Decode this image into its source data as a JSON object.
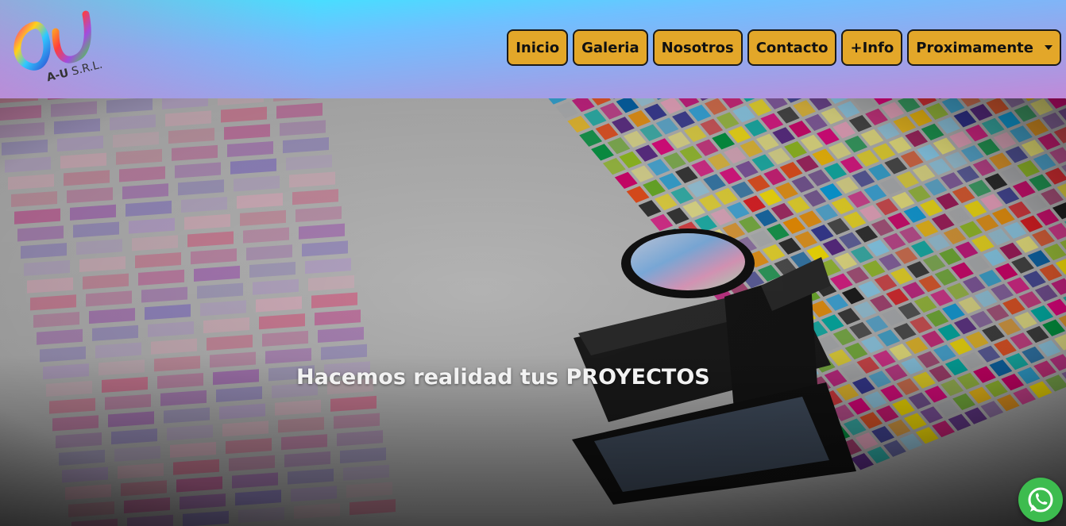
{
  "brand": {
    "logo_name": "A-U S.R.L. logo",
    "logo_text_bold": "A-U",
    "logo_text_rest": " S.R.L."
  },
  "nav": {
    "items": [
      {
        "label": "Inicio"
      },
      {
        "label": "Galeria"
      },
      {
        "label": "Nosotros"
      },
      {
        "label": "Contacto"
      },
      {
        "label": "+Info"
      },
      {
        "label": "Proximamente"
      }
    ]
  },
  "hero": {
    "title": "Hacemos realidad tus  PROYECTOS",
    "image_icon": "color-chart-loupe-photo"
  },
  "floating": {
    "whatsapp_icon": "whatsapp-icon"
  },
  "colors": {
    "nav_button": "#e3a729",
    "whatsapp": "#3dbc4f"
  }
}
